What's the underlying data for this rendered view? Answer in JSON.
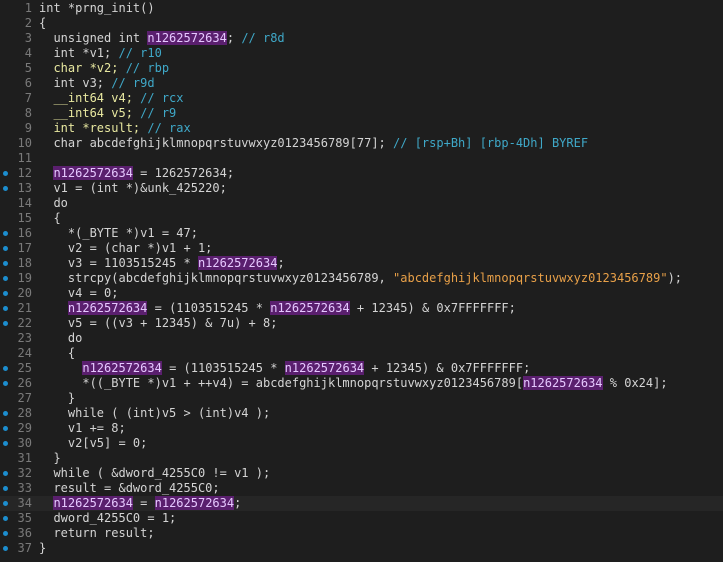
{
  "editor": {
    "lines": [
      {
        "n": "1",
        "bp": false,
        "seg": [
          [
            "int *prng_init()",
            "t"
          ]
        ]
      },
      {
        "n": "2",
        "bp": false,
        "seg": [
          [
            "{",
            "t"
          ]
        ]
      },
      {
        "n": "3",
        "bp": false,
        "seg": [
          [
            "  unsigned int ",
            "t"
          ],
          [
            "n1262572634",
            "h"
          ],
          [
            "; ",
            "t"
          ],
          [
            "// r8d",
            "c"
          ]
        ]
      },
      {
        "n": "4",
        "bp": false,
        "seg": [
          [
            "  int *v1; ",
            "t"
          ],
          [
            "// r10",
            "c"
          ]
        ]
      },
      {
        "n": "5",
        "bp": false,
        "seg": [
          [
            "  char *v2; ",
            "y"
          ],
          [
            "// rbp",
            "c"
          ]
        ]
      },
      {
        "n": "6",
        "bp": false,
        "seg": [
          [
            "  int v3; ",
            "t"
          ],
          [
            "// r9d",
            "c"
          ]
        ]
      },
      {
        "n": "7",
        "bp": false,
        "seg": [
          [
            "  __int64 v4; ",
            "y"
          ],
          [
            "// rcx",
            "c"
          ]
        ]
      },
      {
        "n": "8",
        "bp": false,
        "seg": [
          [
            "  __int64 v5; ",
            "y"
          ],
          [
            "// r9",
            "c"
          ]
        ]
      },
      {
        "n": "9",
        "bp": false,
        "seg": [
          [
            "  int *result; ",
            "y"
          ],
          [
            "// rax",
            "c"
          ]
        ]
      },
      {
        "n": "10",
        "bp": false,
        "seg": [
          [
            "  char abcdefghijklmnopqrstuvwxyz0123456789[77]; ",
            "t"
          ],
          [
            "// [rsp+Bh] [rbp-4Dh] BYREF",
            "c"
          ]
        ]
      },
      {
        "n": "11",
        "bp": false,
        "seg": [
          [
            "",
            "t"
          ]
        ]
      },
      {
        "n": "12",
        "bp": true,
        "seg": [
          [
            "  ",
            "t"
          ],
          [
            "n1262572634",
            "h"
          ],
          [
            " = 1262572634;",
            "t"
          ]
        ]
      },
      {
        "n": "13",
        "bp": true,
        "seg": [
          [
            "  v1 = (int *)&unk_425220;",
            "t"
          ]
        ]
      },
      {
        "n": "14",
        "bp": false,
        "seg": [
          [
            "  do",
            "t"
          ]
        ]
      },
      {
        "n": "15",
        "bp": false,
        "seg": [
          [
            "  {",
            "t"
          ]
        ]
      },
      {
        "n": "16",
        "bp": true,
        "seg": [
          [
            "    *(_BYTE *)v1 = 47;",
            "t"
          ]
        ]
      },
      {
        "n": "17",
        "bp": true,
        "seg": [
          [
            "    v2 = (char *)v1 + 1;",
            "t"
          ]
        ]
      },
      {
        "n": "18",
        "bp": true,
        "seg": [
          [
            "    v3 = 1103515245 * ",
            "t"
          ],
          [
            "n1262572634",
            "h"
          ],
          [
            ";",
            "t"
          ]
        ]
      },
      {
        "n": "19",
        "bp": true,
        "seg": [
          [
            "    strcpy(abcdefghijklmnopqrstuvwxyz0123456789, ",
            "t"
          ],
          [
            "\"abcdefghijklmnopqrstuvwxyz0123456789\"",
            "s"
          ],
          [
            ");",
            "t"
          ]
        ]
      },
      {
        "n": "20",
        "bp": true,
        "seg": [
          [
            "    v4 = 0;",
            "t"
          ]
        ]
      },
      {
        "n": "21",
        "bp": true,
        "seg": [
          [
            "    ",
            "t"
          ],
          [
            "n1262572634",
            "h"
          ],
          [
            " = (1103515245 * ",
            "t"
          ],
          [
            "n1262572634",
            "h"
          ],
          [
            " + 12345) & 0x7FFFFFFF;",
            "t"
          ]
        ]
      },
      {
        "n": "22",
        "bp": true,
        "seg": [
          [
            "    v5 = ((v3 + 12345) & 7u) + 8;",
            "t"
          ]
        ]
      },
      {
        "n": "23",
        "bp": false,
        "seg": [
          [
            "    do",
            "t"
          ]
        ]
      },
      {
        "n": "24",
        "bp": false,
        "seg": [
          [
            "    {",
            "t"
          ]
        ]
      },
      {
        "n": "25",
        "bp": true,
        "seg": [
          [
            "      ",
            "t"
          ],
          [
            "n1262572634",
            "h"
          ],
          [
            " = (1103515245 * ",
            "t"
          ],
          [
            "n1262572634",
            "h"
          ],
          [
            " + 12345) & 0x7FFFFFFF;",
            "t"
          ]
        ]
      },
      {
        "n": "26",
        "bp": true,
        "seg": [
          [
            "      *((_BYTE *)v1 + ++v4) = abcdefghijklmnopqrstuvwxyz0123456789[",
            "t"
          ],
          [
            "n1262572634",
            "h"
          ],
          [
            " % 0x24];",
            "t"
          ]
        ]
      },
      {
        "n": "27",
        "bp": false,
        "seg": [
          [
            "    }",
            "t"
          ]
        ]
      },
      {
        "n": "28",
        "bp": true,
        "seg": [
          [
            "    while ( (int)v5 > (int)v4 );",
            "t"
          ]
        ]
      },
      {
        "n": "29",
        "bp": true,
        "seg": [
          [
            "    v1 += 8;",
            "t"
          ]
        ]
      },
      {
        "n": "30",
        "bp": true,
        "seg": [
          [
            "    v2[v5] = 0;",
            "t"
          ]
        ]
      },
      {
        "n": "31",
        "bp": false,
        "seg": [
          [
            "  }",
            "t"
          ]
        ]
      },
      {
        "n": "32",
        "bp": true,
        "seg": [
          [
            "  while ( &dword_4255C0 != v1 );",
            "t"
          ]
        ]
      },
      {
        "n": "33",
        "bp": true,
        "seg": [
          [
            "  result = &dword_4255C0;",
            "t"
          ]
        ]
      },
      {
        "n": "34",
        "bp": true,
        "cur": true,
        "seg": [
          [
            "  ",
            "t"
          ],
          [
            "n1262572634",
            "h"
          ],
          [
            " = ",
            "t"
          ],
          [
            "n1262572634",
            "h"
          ],
          [
            ";",
            "t"
          ]
        ]
      },
      {
        "n": "35",
        "bp": true,
        "seg": [
          [
            "  dword_4255C0 = 1;",
            "t"
          ]
        ]
      },
      {
        "n": "36",
        "bp": true,
        "seg": [
          [
            "  return result;",
            "t"
          ]
        ]
      },
      {
        "n": "37",
        "bp": true,
        "seg": [
          [
            "}",
            "t"
          ]
        ]
      }
    ]
  },
  "colors": {
    "background": "#1e1e1e",
    "breakpoint": "#1d8ecf",
    "highlight": "#5a1f6e",
    "comment": "#3fa8c8",
    "string": "#e8a048"
  }
}
